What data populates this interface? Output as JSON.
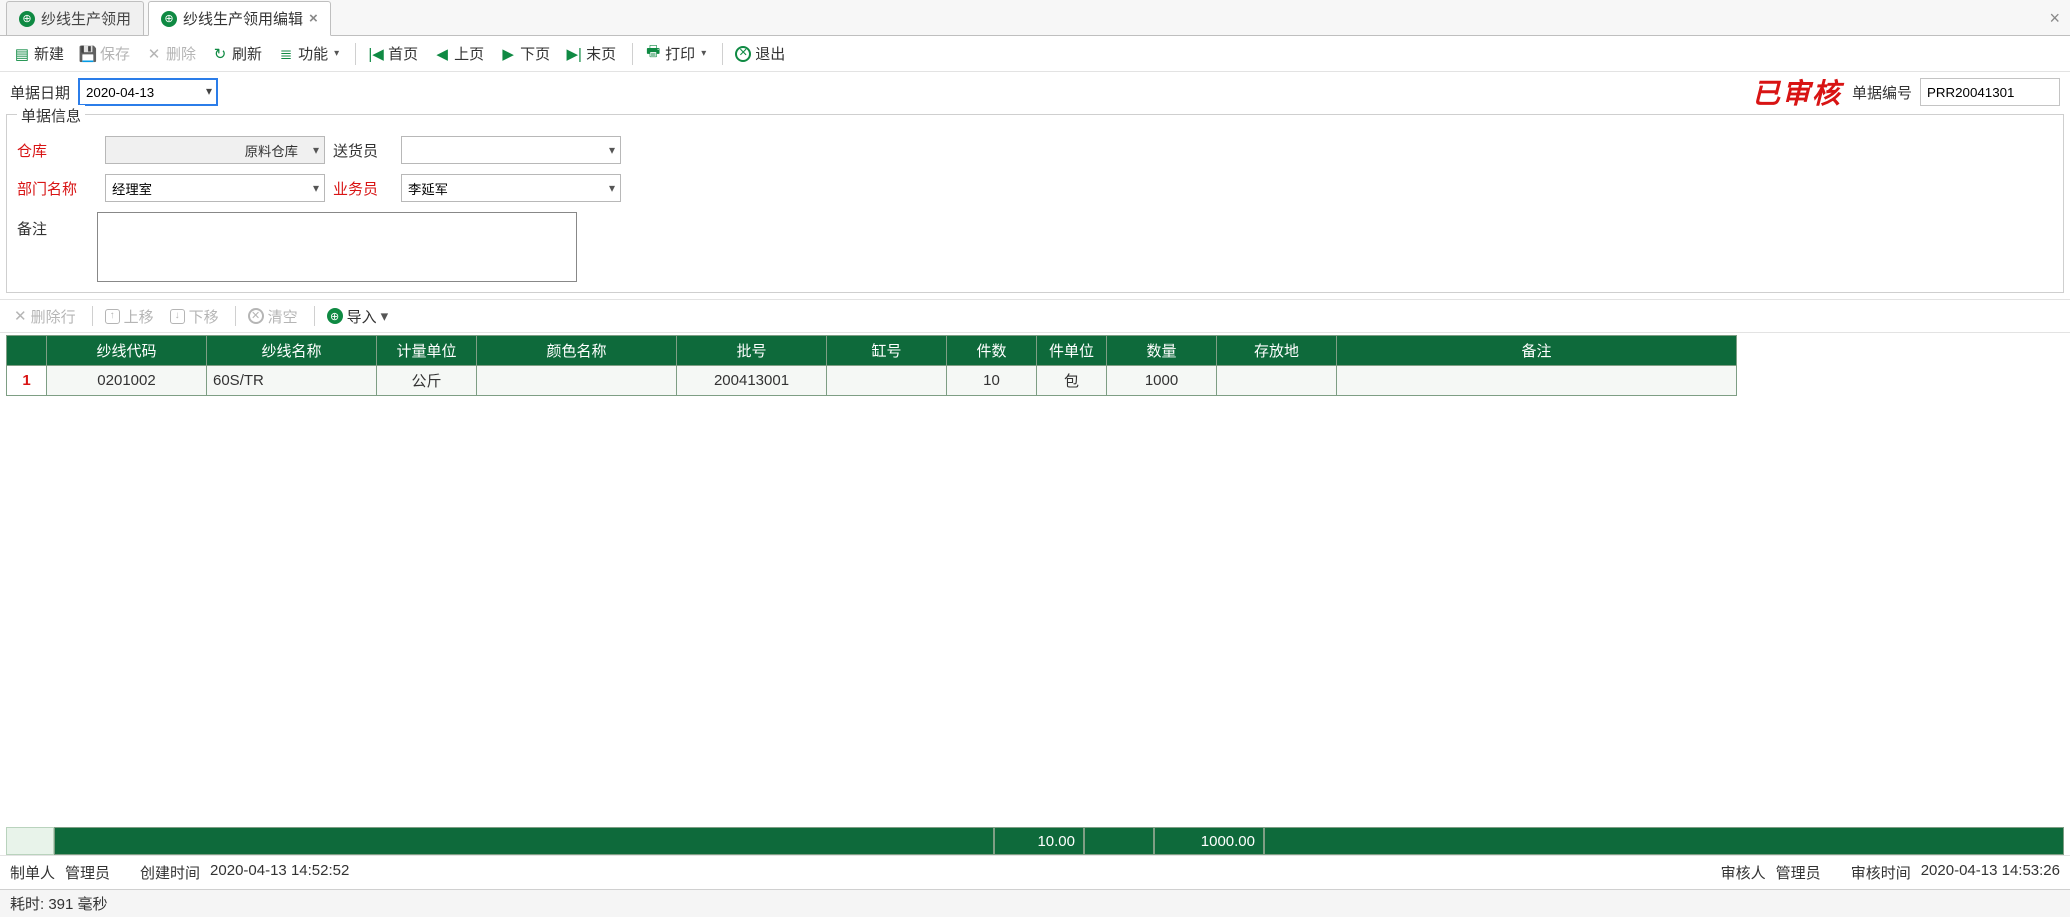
{
  "tabs": {
    "items": [
      {
        "label": "纱线生产领用",
        "active": false
      },
      {
        "label": "纱线生产领用编辑",
        "active": true
      }
    ]
  },
  "toolbar": {
    "new": "新建",
    "save": "保存",
    "delete": "删除",
    "refresh": "刷新",
    "function": "功能",
    "first": "首页",
    "prev": "上页",
    "next": "下页",
    "last": "末页",
    "print": "打印",
    "exit": "退出"
  },
  "doc": {
    "date_label": "单据日期",
    "date_value": "2020-04-13",
    "approved_label": "已审核",
    "number_label": "单据编号",
    "number_value": "PRR20041301"
  },
  "info": {
    "legend": "单据信息",
    "labels": {
      "warehouse": "仓库",
      "deliverer": "送货员",
      "dept": "部门名称",
      "salesman": "业务员",
      "remark": "备注"
    },
    "values": {
      "warehouse": "原料仓库",
      "deliverer": "",
      "dept": "经理室",
      "salesman": "李延军",
      "remark": ""
    }
  },
  "row_toolbar": {
    "del_row": "删除行",
    "move_up": "上移",
    "move_down": "下移",
    "clear": "清空",
    "import": "导入"
  },
  "grid": {
    "headers": [
      "",
      "纱线代码",
      "纱线名称",
      "计量单位",
      "颜色名称",
      "批号",
      "缸号",
      "件数",
      "件单位",
      "数量",
      "存放地",
      "备注"
    ],
    "rows": [
      {
        "n": "1",
        "code": "0201002",
        "name": "60S/TR",
        "unit": "公斤",
        "color": "",
        "batch": "200413001",
        "vat": "",
        "pcs": "10",
        "pcs_unit": "包",
        "qty": "1000",
        "loc": "",
        "remark": ""
      }
    ],
    "totals": {
      "pcs": "10.00",
      "qty": "1000.00"
    }
  },
  "footer": {
    "maker_label": "制单人",
    "maker": "管理员",
    "created_label": "创建时间",
    "created": "2020-04-13 14:52:52",
    "auditor_label": "审核人",
    "auditor": "管理员",
    "audit_time_label": "审核时间",
    "audit_time": "2020-04-13 14:53:26"
  },
  "status": {
    "elapsed_label": "耗时:",
    "elapsed": "391 毫秒"
  }
}
